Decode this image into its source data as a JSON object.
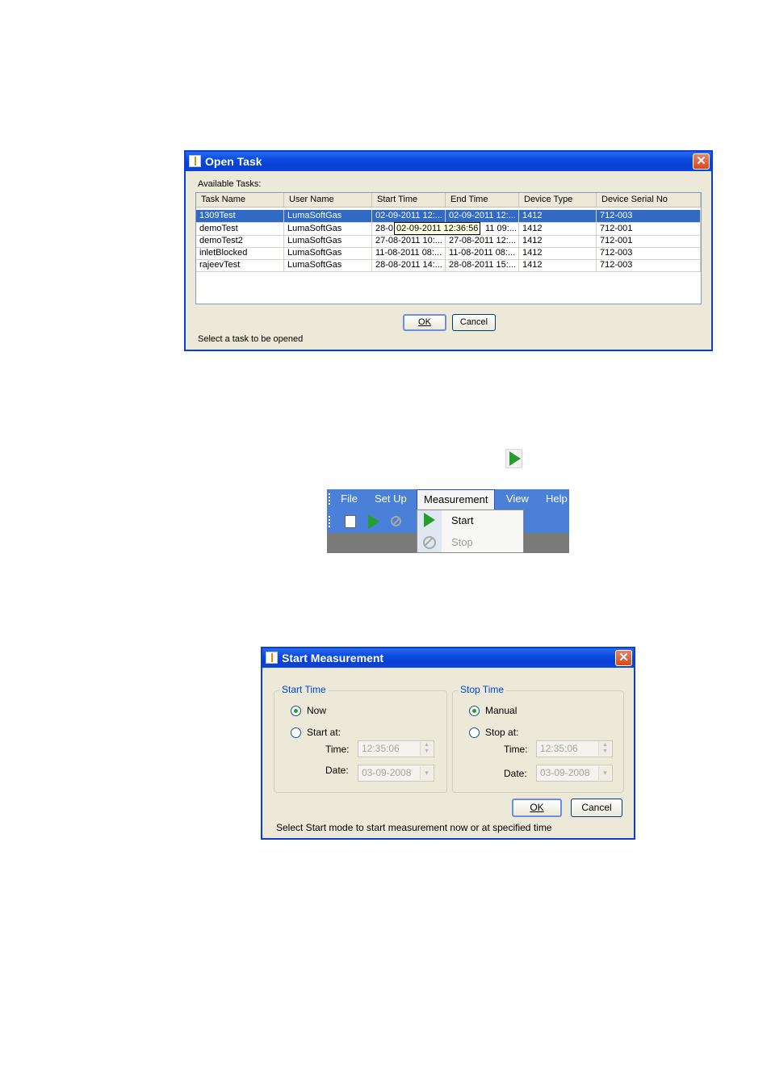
{
  "open_task": {
    "title": "Open Task",
    "close_glyph": "✕",
    "available_label": "Available Tasks:",
    "columns": [
      "Task Name",
      "User Name",
      "Start Time",
      "End Time",
      "Device Type",
      "Device Serial No"
    ],
    "rows": [
      [
        "1309Test",
        "LumaSoftGas",
        "02-09-2011 12:...",
        "02-09-2011 12:...",
        "1412",
        "712-003"
      ],
      [
        "demoTest",
        "LumaSoftGas",
        "28-0",
        "11 09:...",
        "1412",
        "712-001"
      ],
      [
        "demoTest2",
        "LumaSoftGas",
        "27-08-2011 10:...",
        "27-08-2011 12:...",
        "1412",
        "712-001"
      ],
      [
        "inletBlocked",
        "LumaSoftGas",
        "11-08-2011 08:...",
        "11-08-2011 08:...",
        "1412",
        "712-003"
      ],
      [
        "rajeevTest",
        "LumaSoftGas",
        "28-08-2011 14:...",
        "28-08-2011 15:...",
        "1412",
        "712-003"
      ]
    ],
    "tooltip": "02-09-2011 12:36:56",
    "ok_label": "OK",
    "cancel_label": "Cancel",
    "status": "Select a task to be opened"
  },
  "menu": {
    "items": [
      "File",
      "Set Up",
      "Measurement",
      "View",
      "Help"
    ],
    "dropdown": [
      "Start",
      "Stop"
    ]
  },
  "start_measurement": {
    "title": "Start Measurement",
    "start_group": "Start Time",
    "stop_group": "Stop Time",
    "now_label": "Now",
    "start_at_label": "Start at:",
    "manual_label": "Manual",
    "stop_at_label": "Stop at:",
    "time_label": "Time:",
    "date_label": "Date:",
    "start_time_value": "12:35:06",
    "start_date_value": "03-09-2008",
    "stop_time_value": "12:35:06",
    "stop_date_value": "03-09-2008",
    "ok_label": "OK",
    "cancel_label": "Cancel",
    "status": "Select Start mode to start measurement now or at specified time"
  },
  "icons": {
    "play_color": "#22a02a",
    "accent": "#0a3ed8",
    "selection": "#316ac5"
  }
}
